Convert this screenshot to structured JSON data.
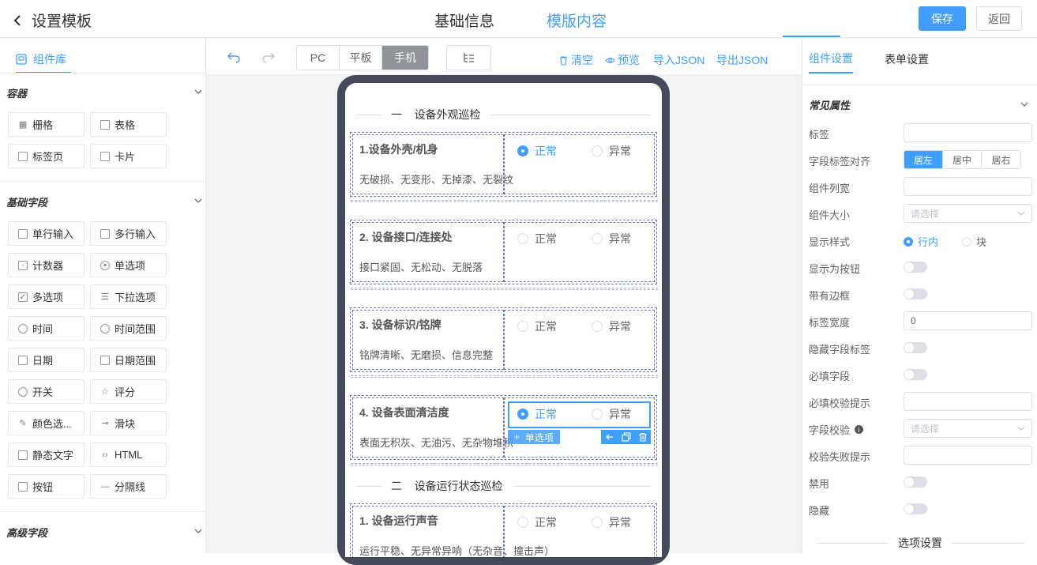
{
  "header": {
    "back_title": "设置模板",
    "tabs": [
      "基础信息",
      "模版内容"
    ],
    "save": "保存",
    "back": "返回"
  },
  "library": {
    "tab": "组件库",
    "groups": [
      {
        "title": "容器",
        "items": [
          {
            "label": "栅格",
            "icon": "grid-icon"
          },
          {
            "label": "表格",
            "icon": "table-icon"
          },
          {
            "label": "标签页",
            "icon": "tabs-icon"
          },
          {
            "label": "卡片",
            "icon": "card-icon"
          }
        ]
      },
      {
        "title": "基础字段",
        "items": [
          {
            "label": "单行输入",
            "icon": "input-icon"
          },
          {
            "label": "多行输入",
            "icon": "textarea-icon"
          },
          {
            "label": "计数器",
            "icon": "counter-icon"
          },
          {
            "label": "单选项",
            "icon": "radio-icon"
          },
          {
            "label": "多选项",
            "icon": "checkbox-icon"
          },
          {
            "label": "下拉选项",
            "icon": "select-icon"
          },
          {
            "label": "时间",
            "icon": "clock-icon"
          },
          {
            "label": "时间范围",
            "icon": "time-range-icon"
          },
          {
            "label": "日期",
            "icon": "calendar-icon"
          },
          {
            "label": "日期范围",
            "icon": "date-range-icon"
          },
          {
            "label": "开关",
            "icon": "switch-icon"
          },
          {
            "label": "评分",
            "icon": "star-icon"
          },
          {
            "label": "颜色选...",
            "icon": "color-picker-icon"
          },
          {
            "label": "滑块",
            "icon": "slider-icon"
          },
          {
            "label": "静态文字",
            "icon": "static-text-icon"
          },
          {
            "label": "HTML",
            "icon": "code-icon"
          },
          {
            "label": "按钮",
            "icon": "button-icon"
          },
          {
            "label": "分隔线",
            "icon": "divider-icon"
          }
        ]
      },
      {
        "title": "高级字段",
        "items": []
      }
    ]
  },
  "toolbar": {
    "devices": [
      "PC",
      "平板",
      "手机"
    ],
    "active_device": "手机",
    "actions": [
      "清空",
      "预览",
      "导入JSON",
      "导出JSON"
    ]
  },
  "canvas": {
    "sections": [
      {
        "num": "一",
        "title": "设备外观巡检"
      },
      {
        "num": "二",
        "title": "设备运行状态巡检"
      }
    ],
    "options": [
      "正常",
      "异常"
    ],
    "cards": [
      {
        "title": "1.设备外壳/机身",
        "desc": "无破损、无变形、无掉漆、无裂纹",
        "checked": true
      },
      {
        "title": "2. 设备接口/连接处",
        "desc": "接口紧固、无松动、无脱落",
        "checked": false
      },
      {
        "title": "3. 设备标识/铭牌",
        "desc": "铭牌清晰、无磨损、信息完整",
        "checked": false
      },
      {
        "title": "4. 设备表面清洁度",
        "desc": "表面无积灰、无油污、无杂物堆积",
        "checked": true,
        "selected": true
      },
      {
        "title": "1. 设备运行声音",
        "desc": "运行平稳、无异常异响（无杂音、撞击声）",
        "checked": false
      }
    ],
    "selected_tag": "单选项"
  },
  "props": {
    "tabs": [
      "组件设置",
      "表单设置"
    ],
    "section": "常见属性",
    "rows": {
      "label": "标签",
      "align": "字段标签对齐",
      "width": "组件列宽",
      "size": "组件大小",
      "display": "显示样式",
      "as_button": "显示为按钮",
      "border": "带有边框",
      "label_width": "标签宽度",
      "hide_label": "隐藏字段标签",
      "required": "必填字段",
      "required_msg": "必填校验提示",
      "validate": "字段校验",
      "validate_msg": "校验失败提示",
      "disabled": "禁用",
      "hidden": "隐藏"
    },
    "align_options": [
      "居左",
      "居中",
      "居右"
    ],
    "align_selected": "居左",
    "size_placeholder": "请选择",
    "display_options": [
      "行内",
      "块"
    ],
    "display_selected": "行内",
    "label_width_value": "0",
    "validate_placeholder": "请选择",
    "options_section": "选项设置"
  }
}
